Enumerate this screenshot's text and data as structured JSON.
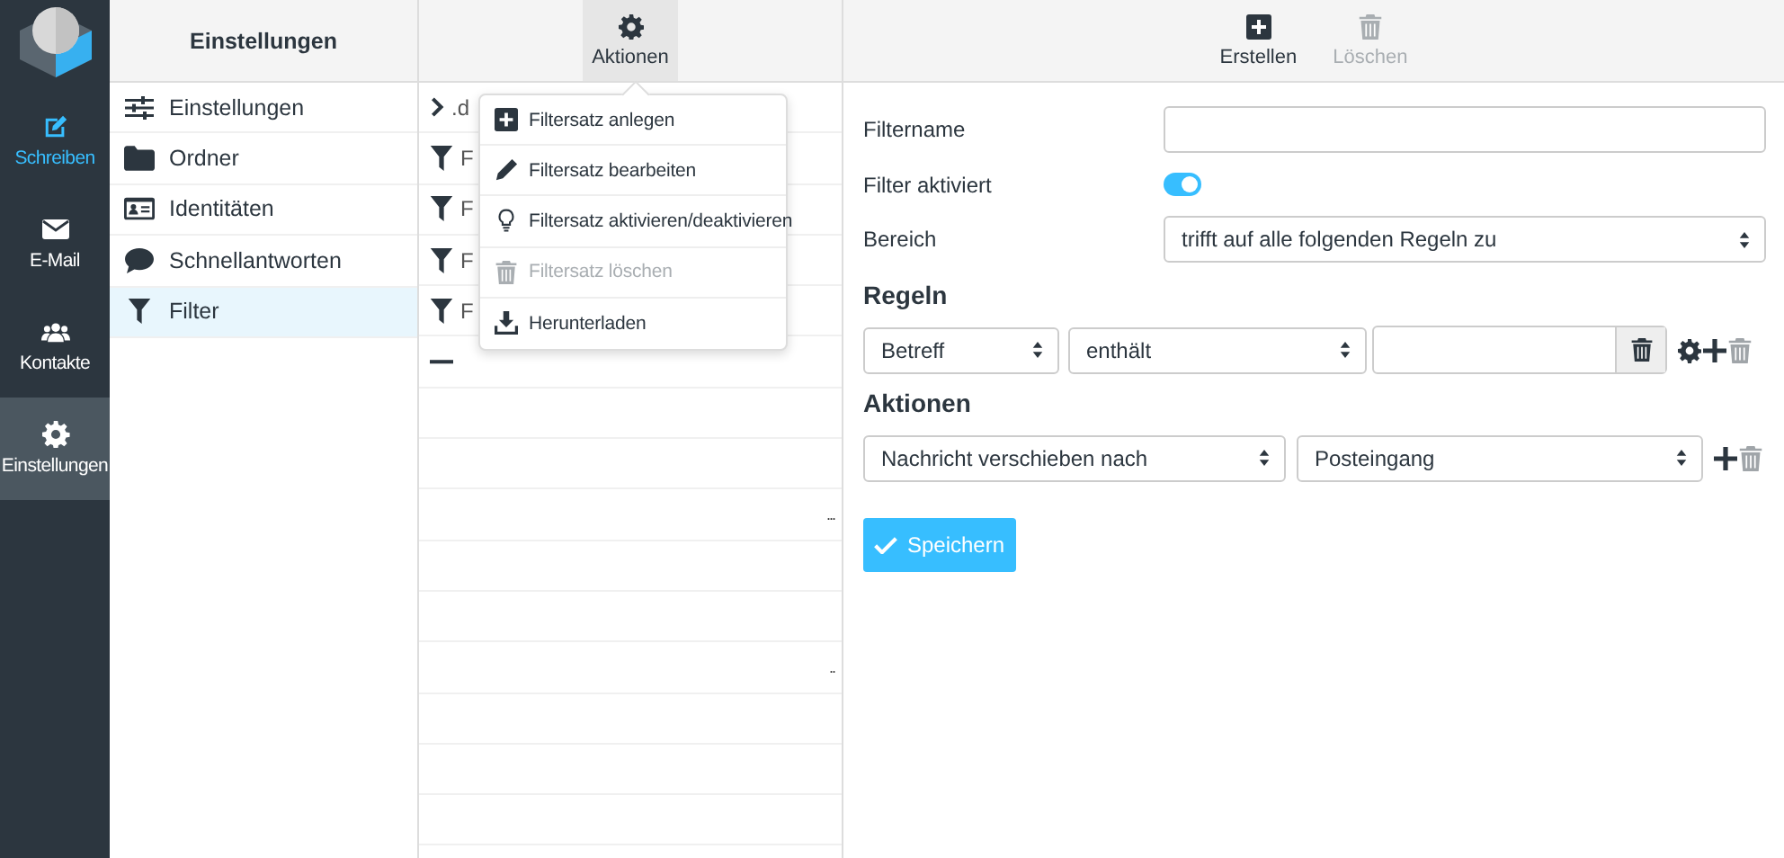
{
  "nav": [
    {
      "label": "Schreiben",
      "kind": "accent",
      "selected": false
    },
    {
      "label": "E-Mail",
      "kind": "plain",
      "selected": false
    },
    {
      "label": "Kontakte",
      "kind": "plain",
      "selected": false
    },
    {
      "label": "Einstellungen",
      "kind": "plain",
      "selected": true
    }
  ],
  "settings": {
    "title": "Einstellungen",
    "items": [
      {
        "label": "Einstellungen",
        "selected": false
      },
      {
        "label": "Ordner",
        "selected": false
      },
      {
        "label": "Identitäten",
        "selected": false
      },
      {
        "label": "Schnellantworten",
        "selected": false
      },
      {
        "label": "Filter",
        "selected": true
      }
    ]
  },
  "filtersets": {
    "toolbar": {
      "label": "Aktionen"
    },
    "rows": [
      {
        "kind": "set",
        "label": ".d"
      },
      {
        "kind": "filter",
        "label": "F"
      },
      {
        "kind": "filter",
        "label": "F"
      },
      {
        "kind": "filter",
        "label": "F"
      },
      {
        "kind": "filter",
        "label": "F"
      },
      {
        "kind": "new"
      },
      {
        "kind": "empty"
      },
      {
        "kind": "empty"
      },
      {
        "kind": "empty",
        "note": "..."
      },
      {
        "kind": "empty"
      },
      {
        "kind": "empty"
      },
      {
        "kind": "empty",
        "note": ".."
      },
      {
        "kind": "empty"
      },
      {
        "kind": "empty"
      },
      {
        "kind": "empty"
      }
    ]
  },
  "menu": [
    {
      "label": "Filtersatz anlegen",
      "disabled": false
    },
    {
      "label": "Filtersatz bearbeiten",
      "disabled": false
    },
    {
      "label": "Filtersatz aktivieren/deaktivieren",
      "disabled": false
    },
    {
      "label": "Filtersatz löschen",
      "disabled": true
    },
    {
      "label": "Herunterladen",
      "disabled": false
    }
  ],
  "editor": {
    "toolbar": [
      {
        "label": "Erstellen",
        "disabled": false
      },
      {
        "label": "Löschen",
        "disabled": true
      }
    ],
    "name_label": "Filtername",
    "enabled_label": "Filter aktiviert",
    "enabled": true,
    "scope_label": "Bereich",
    "scope": "trifft auf alle folgenden Regeln zu",
    "rules_heading": "Regeln",
    "rules": [
      {
        "header": "Betreff",
        "op": "enthält"
      }
    ],
    "actions_heading": "Aktionen",
    "actions": [
      {
        "type": "Nachricht verschieben nach",
        "target": "Posteingang"
      }
    ],
    "save": "Speichern"
  }
}
